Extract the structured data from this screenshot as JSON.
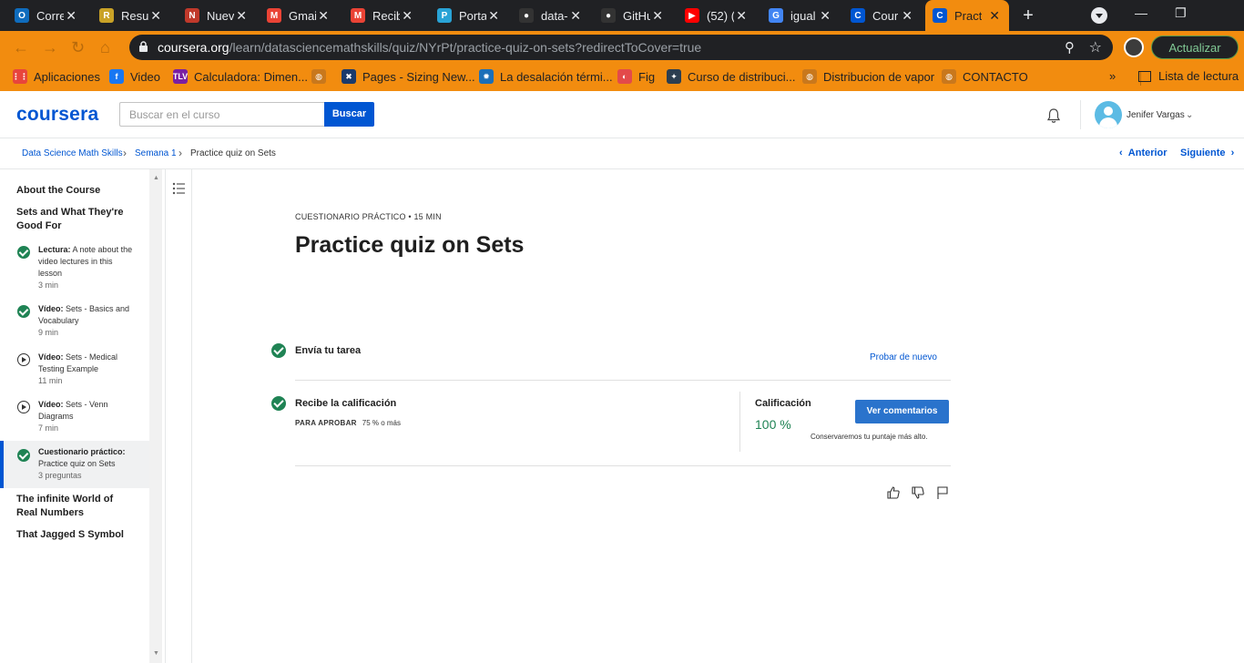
{
  "browser": {
    "tabs": [
      {
        "label": "Corre",
        "icon": "outlook-icon",
        "color": "#0f6cbd",
        "glyph": "O"
      },
      {
        "label": "Resu",
        "icon": "summary-icon",
        "color": "#c9a227",
        "glyph": "R"
      },
      {
        "label": "Nuev",
        "icon": "chrome-icon",
        "color": "#c0392b",
        "glyph": "N"
      },
      {
        "label": "Gmai",
        "icon": "gmail-icon",
        "color": "#ea4335",
        "glyph": "M"
      },
      {
        "label": "Recib",
        "icon": "gmail-icon",
        "color": "#ea4335",
        "glyph": "M"
      },
      {
        "label": "Porta",
        "icon": "portal-icon",
        "color": "#29a3d6",
        "glyph": "P"
      },
      {
        "label": "data-",
        "icon": "github-icon",
        "color": "#333333",
        "glyph": "●"
      },
      {
        "label": "GitHu",
        "icon": "github-icon",
        "color": "#333333",
        "glyph": "●"
      },
      {
        "label": "(52) (",
        "icon": "youtube-icon",
        "color": "#ff0000",
        "glyph": "▶"
      },
      {
        "label": "igual",
        "icon": "google-icon",
        "color": "#4285f4",
        "glyph": "G"
      },
      {
        "label": "Cour",
        "icon": "coursera-icon",
        "color": "#0056d2",
        "glyph": "C"
      },
      {
        "label": "Practi",
        "icon": "coursera-icon",
        "color": "#0056d2",
        "glyph": "C",
        "active": true
      }
    ],
    "url_domain": "coursera.org",
    "url_path": "/learn/datasciencemathskills/quiz/NYrPt/practice-quiz-on-sets?redirectToCover=true",
    "update_label": "Actualizar",
    "bookmarks": [
      {
        "label": "Aplicaciones",
        "icon": "apps-grid-icon",
        "color": "#e8453c",
        "glyph": "⋮⋮"
      },
      {
        "label": "Video",
        "icon": "facebook-icon",
        "color": "#1877f2",
        "glyph": "f"
      },
      {
        "label": "Calculadora: Dimen...",
        "icon": "tlv-icon",
        "color": "#7a1fa2",
        "glyph": "TLV"
      },
      {
        "label": "",
        "icon": "globe-icon",
        "color": "#c9781c",
        "glyph": "◍"
      },
      {
        "label": "Pages - Sizing New...",
        "icon": "pages-icon",
        "color": "#1b3a6b",
        "glyph": "✖"
      },
      {
        "label": "La desalación térmi...",
        "icon": "gear-burst-icon",
        "color": "#1b6fb8",
        "glyph": "✹"
      },
      {
        "label": "Fig",
        "icon": "fig-icon",
        "color": "#e34a4a",
        "glyph": "◐"
      },
      {
        "label": "Curso de distribuci...",
        "icon": "course-icon",
        "color": "#2c3e50",
        "glyph": "✦"
      },
      {
        "label": "Distribucion de vapor",
        "icon": "globe-icon",
        "color": "#c9781c",
        "glyph": "◍"
      },
      {
        "label": "CONTACTO",
        "icon": "globe-icon",
        "color": "#c9781c",
        "glyph": "◍"
      }
    ],
    "reading_list_label": "Lista de lectura",
    "overflow_label": "»"
  },
  "header": {
    "logo": "coursera",
    "search_placeholder": "Buscar en el curso",
    "search_button": "Buscar",
    "user_name": "Jenifer Vargas"
  },
  "breadcrumb": {
    "items": [
      "Data Science Math Skills",
      "Semana 1",
      "Practice quiz on Sets"
    ],
    "prev": "Anterior",
    "next": "Siguiente"
  },
  "sidebar": {
    "sections": [
      "About the Course",
      "Sets and What They're Good For",
      "The infinite World of Real Numbers",
      "That Jagged S Symbol"
    ],
    "items": [
      {
        "type": "Lectura:",
        "name": "A note about the video lectures in this lesson",
        "meta": "3 min",
        "status": "done"
      },
      {
        "type": "Vídeo:",
        "name": "Sets - Basics and Vocabulary",
        "meta": "9 min",
        "status": "done"
      },
      {
        "type": "Vídeo:",
        "name": "Sets - Medical Testing Example",
        "meta": "11 min",
        "status": "play"
      },
      {
        "type": "Vídeo:",
        "name": "Sets - Venn Diagrams",
        "meta": "7 min",
        "status": "play"
      },
      {
        "type": "Cuestionario práctico:",
        "name": "Practice quiz on Sets",
        "meta": "3 preguntas",
        "status": "done",
        "active": true
      }
    ]
  },
  "main": {
    "kicker": "CUESTIONARIO PRÁCTICO • 15 MIN",
    "title": "Practice quiz on Sets",
    "step1_label": "Envía tu tarea",
    "retry_label": "Probar de nuevo",
    "step2_label": "Recibe la calificación",
    "pass_label": "PARA APROBAR",
    "pass_value": "75 % o más",
    "grade_label": "Calificación",
    "grade_value": "100 %",
    "feedback_button": "Ver comentarios",
    "keep_note": "Conservaremos tu puntaje más alto."
  },
  "colors": {
    "accent": "#0056d2",
    "success": "#1f8354",
    "chrome_frame": "#f28c0f"
  }
}
